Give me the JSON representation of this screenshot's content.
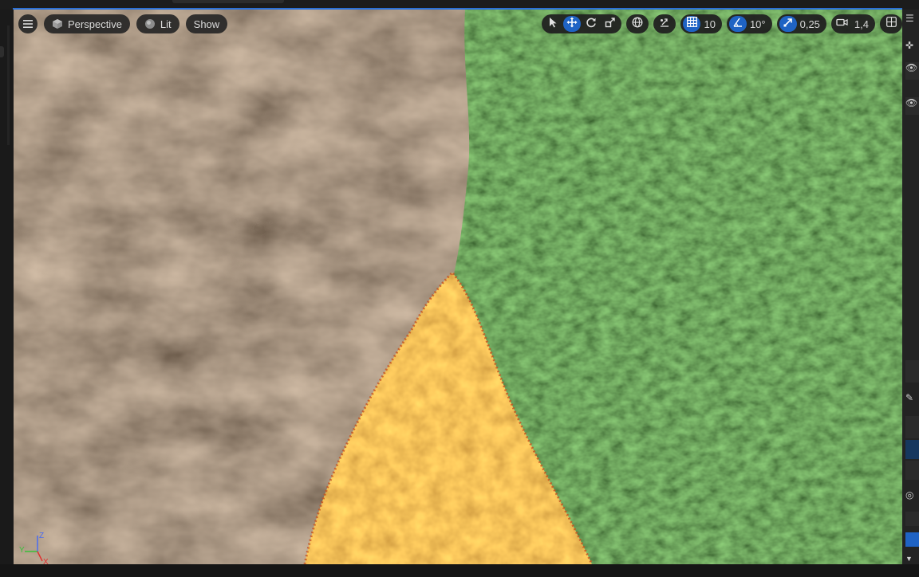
{
  "viewport": {
    "menu_icon": "hamburger-icon",
    "view_mode": {
      "label": "Perspective",
      "icon": "cube-icon"
    },
    "lighting": {
      "label": "Lit",
      "icon": "sphere-icon"
    },
    "show": {
      "label": "Show"
    },
    "transform_tools": [
      "select-icon",
      "translate-icon",
      "rotate-icon",
      "scale-icon"
    ],
    "active_tool": "translate",
    "coordinate_space_icon": "globe-icon",
    "surface_snapping_icon": "surface-snap-icon",
    "grid_snap": {
      "icon": "grid-icon",
      "value": "10",
      "enabled": true
    },
    "rotation_snap": {
      "icon": "angle-icon",
      "value": "10°",
      "enabled": true
    },
    "scale_snap": {
      "icon": "scale-snap-icon",
      "value": "0,25",
      "enabled": true
    },
    "camera_speed": {
      "icon": "camera-icon",
      "value": "1,4"
    },
    "layout_icon": "viewport-layout-icon"
  },
  "axis_indicator": {
    "x": "X",
    "y": "Y",
    "z": "Z"
  },
  "colors": {
    "accent": "#1f63c4",
    "dirt": "#5b4637",
    "grass": "#2f4a24",
    "highlight": "#e0882c"
  }
}
